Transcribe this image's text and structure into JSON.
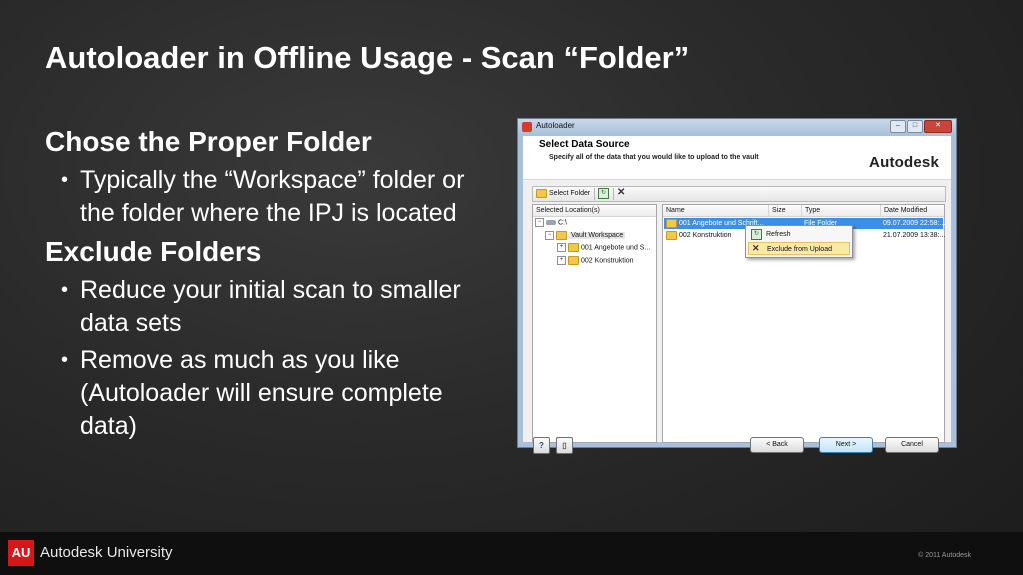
{
  "slide": {
    "title": "Autoloader in Offline Usage - Scan “Folder”",
    "sections": [
      {
        "heading": "Chose the Proper Folder",
        "bullets": [
          "Typically the “Workspace” folder or the folder where the IPJ is located"
        ]
      },
      {
        "heading": "Exclude Folders",
        "bullets": [
          "Reduce your initial scan to smaller data sets",
          "Remove as much as you like (Autoloader will ensure complete data)"
        ]
      }
    ]
  },
  "footer": {
    "logo": "AU",
    "brand": "Autodesk University",
    "copyright": "© 2011 Autodesk"
  },
  "dialog": {
    "title": "Autoloader",
    "header_title": "Select Data Source",
    "header_subtitle": "Specify all of the data that you would like to upload to the vault",
    "brand": "Autodesk",
    "window_buttons": {
      "minimize": "–",
      "maximize": "□",
      "close": "✕"
    },
    "toolbar": {
      "select_folder": "Select Folder",
      "refresh_icon": "↻",
      "remove_icon": "✕"
    },
    "tree": {
      "header": "Selected Location(s)",
      "items": [
        "C:\\",
        "Vault Workspace",
        "001 Angebote und S...",
        "002 Konstruktion"
      ]
    },
    "list": {
      "columns": [
        "Name",
        "Size",
        "Type",
        "Date Modified"
      ],
      "rows": [
        {
          "name": "001 Angebote und Schrift...",
          "size": "",
          "type": "File Folder",
          "date": "09.07.2009 22:58:..."
        },
        {
          "name": "002 Konstruktion",
          "size": "",
          "type": "",
          "date": "21.07.2009 13:38:..."
        }
      ]
    },
    "context_menu": [
      "Refresh",
      "Exclude from Upload"
    ],
    "buttons": {
      "help": "?",
      "log": "▯",
      "back": "< Back",
      "next": "Next >",
      "cancel": "Cancel"
    }
  }
}
